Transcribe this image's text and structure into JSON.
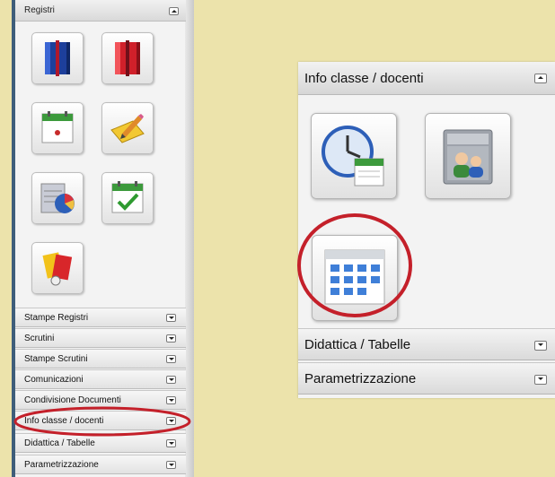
{
  "left_panel": {
    "header": "Registri",
    "icons": [
      {
        "name": "blue-register-icon"
      },
      {
        "name": "red-register-icon"
      },
      {
        "name": "calendar-dot-icon"
      },
      {
        "name": "notepad-pencil-icon"
      },
      {
        "name": "report-chart-icon"
      },
      {
        "name": "calendar-check-icon"
      },
      {
        "name": "cards-icon"
      }
    ],
    "sections": [
      "Stampe Registri",
      "Scrutini",
      "Stampe Scrutini",
      "Comunicazioni",
      "Condivisione Documenti",
      "Info classe / docenti",
      "Didattica / Tabelle",
      "Parametrizzazione"
    ],
    "highlighted_section": "Info classe / docenti"
  },
  "right_panel": {
    "header": "Info classe / docenti",
    "icons": [
      {
        "name": "clock-calendar-icon"
      },
      {
        "name": "users-database-icon"
      },
      {
        "name": "timetable-grid-icon"
      }
    ],
    "sections": [
      "Didattica / Tabelle",
      "Parametrizzazione"
    ],
    "highlighted_icon": "timetable-grid-icon"
  },
  "colors": {
    "background": "#ece3ab",
    "highlight_ring": "#c4202a"
  }
}
